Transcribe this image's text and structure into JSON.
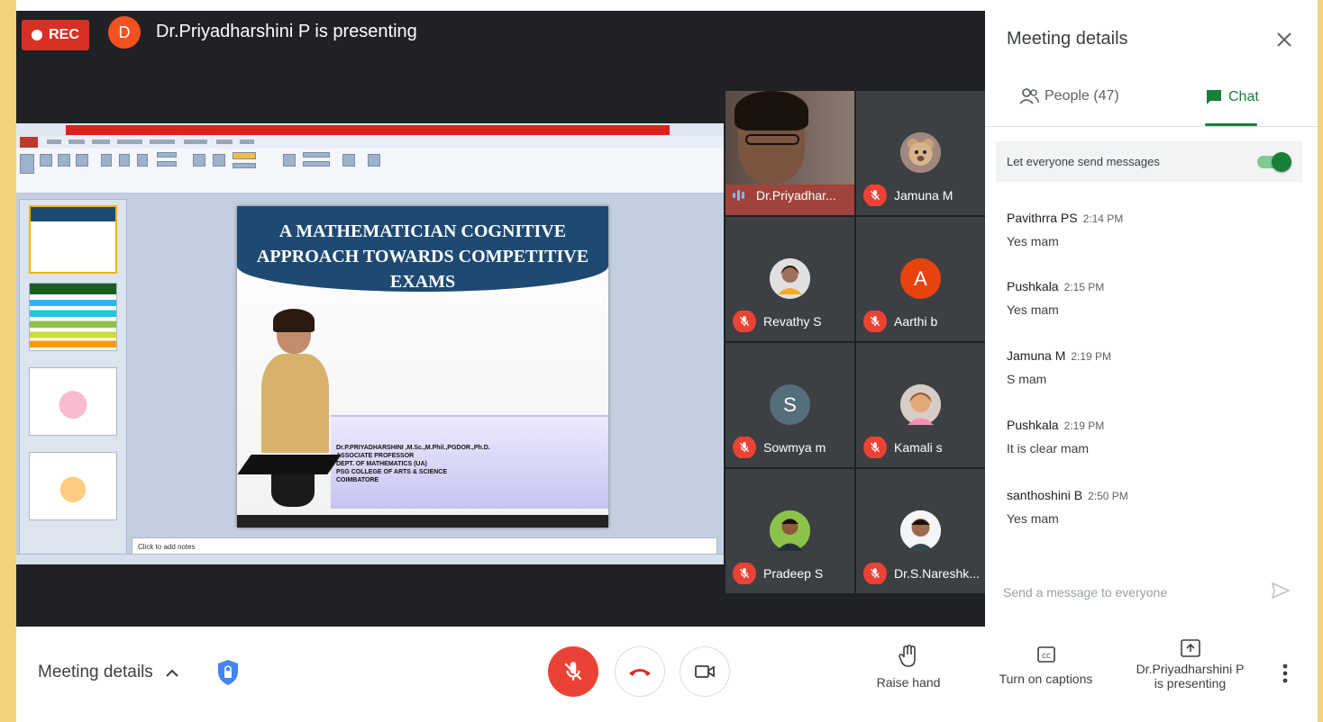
{
  "header": {
    "rec_label": "REC",
    "presenter_initial": "D",
    "presenting_text": "Dr.Priyadharshini P is presenting"
  },
  "slide": {
    "title_lines": [
      "A MATHEMATICIAN COGNITIVE",
      "APPROACH TOWARDS COMPETITIVE",
      "EXAMS"
    ],
    "info_lines": [
      "Dr.P.PRIYADHARSHINI ,M.Sc.,M.Phil.,PGDOR.,Ph.D.",
      "ASSOCIATE PROFESSOR",
      "DEPT. OF MATHEMATICS (UA)",
      "PSG COLLEGE OF ARTS & SCIENCE",
      "COIMBATORE"
    ],
    "notes_placeholder": "Click to add notes"
  },
  "participants": [
    {
      "name": "Dr.Priyadhar...",
      "state": "speaking",
      "avatar": "video"
    },
    {
      "name": "Jamuna M",
      "state": "muted",
      "avatar": "photo-teddy"
    },
    {
      "name": "Revathy S",
      "state": "muted",
      "avatar": "photo-woman"
    },
    {
      "name": "Aarthi b",
      "state": "muted",
      "avatar": "letter",
      "initial": "A",
      "color": "#e8430c"
    },
    {
      "name": "Sowmya m",
      "state": "muted",
      "avatar": "letter",
      "initial": "S",
      "color": "#546e7a"
    },
    {
      "name": "Kamali s",
      "state": "muted",
      "avatar": "photo-child"
    },
    {
      "name": "Pradeep S",
      "state": "muted",
      "avatar": "photo-man"
    },
    {
      "name": "Dr.S.Nareshk...",
      "state": "muted",
      "avatar": "photo-man2"
    }
  ],
  "panel": {
    "title": "Meeting details",
    "tab_people": "People (47)",
    "tab_chat": "Chat",
    "toggle_label": "Let everyone send messages",
    "toggle_on": true,
    "messages": [
      {
        "sender": "Pavithrra PS",
        "time": "2:14 PM",
        "text": "Yes mam"
      },
      {
        "sender": "Pushkala",
        "time": "2:15 PM",
        "text": "Yes mam"
      },
      {
        "sender": "Jamuna M",
        "time": "2:19 PM",
        "text": "S mam"
      },
      {
        "sender": "Pushkala",
        "time": "2:19 PM",
        "text": "It is clear mam"
      },
      {
        "sender": "santhoshini B",
        "time": "2:50 PM",
        "text": "Yes mam"
      }
    ],
    "send_placeholder": "Send a message to everyone"
  },
  "bottombar": {
    "meeting_details": "Meeting details",
    "raise_hand": "Raise hand",
    "captions": "Turn on captions",
    "presenting_line1": "Dr.Priyadharshini P",
    "presenting_line2": "is presenting"
  },
  "colors": {
    "accent_green": "#188038",
    "danger_red": "#ea4335",
    "stage_bg": "#202124"
  }
}
